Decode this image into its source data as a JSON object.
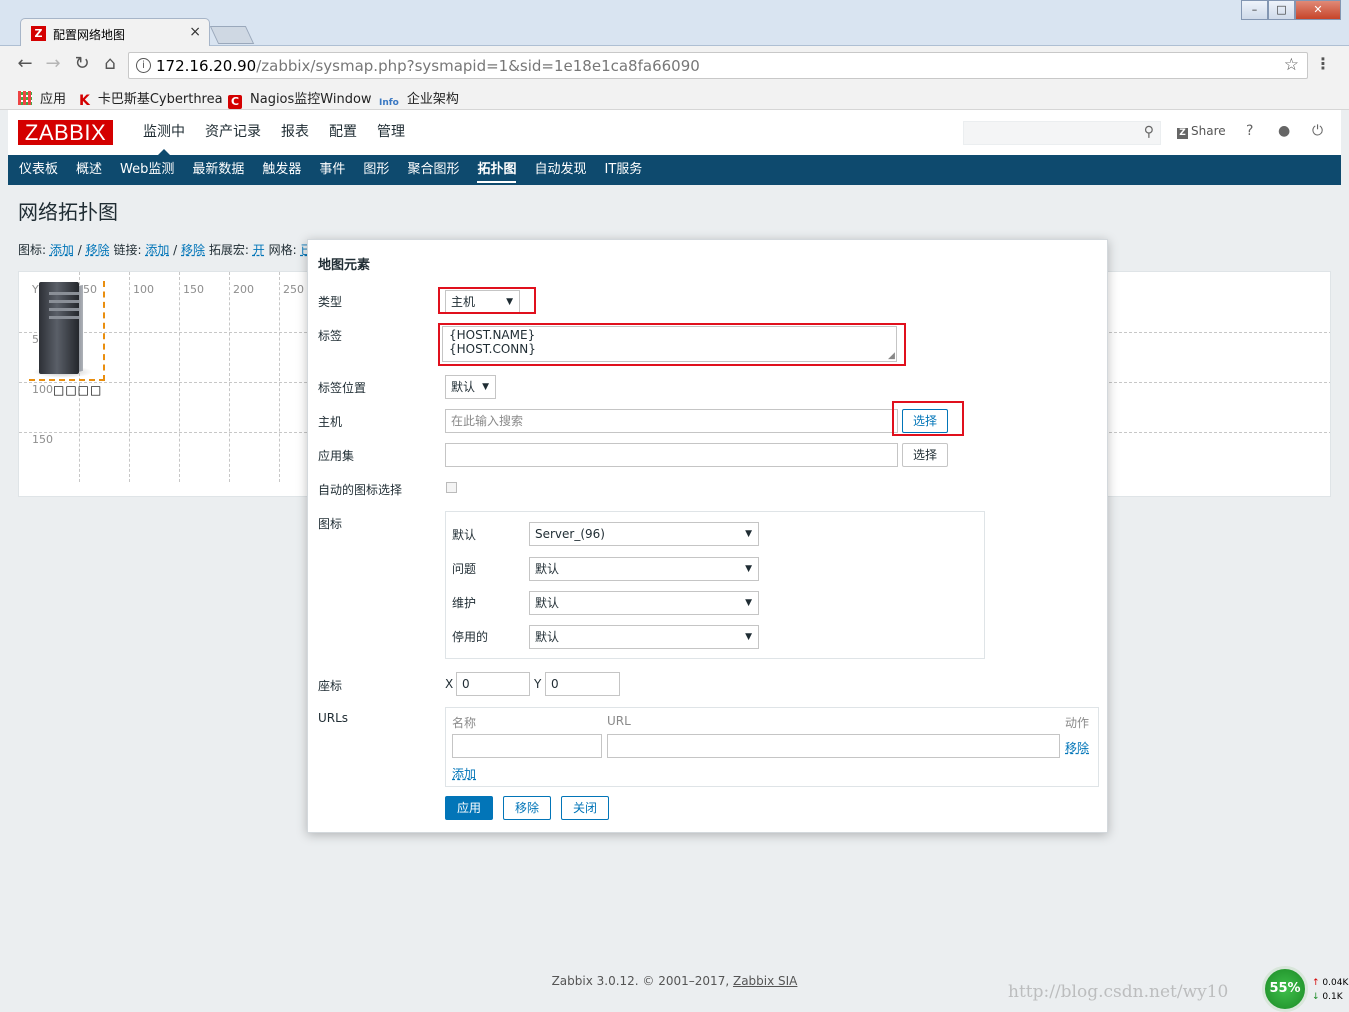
{
  "browser": {
    "tab_title": "配置网络地图",
    "tab_close": "×",
    "url_host": "172.16.20.90",
    "url_path": "/zabbix/sysmap.php?sysmapid=1&sid=1e18e1ca8fa66090",
    "bookmarks": [
      "应用",
      "卡巴斯基Cyberthrea",
      "Nagios监控Window",
      "企业架构"
    ]
  },
  "zabbix": {
    "logo": "ZABBIX",
    "top_menu": [
      "监测中",
      "资产记录",
      "报表",
      "配置",
      "管理"
    ],
    "share_label": "Share",
    "help_icon": "?",
    "sub_menu": [
      "仪表板",
      "概述",
      "Web监测",
      "最新数据",
      "触发器",
      "事件",
      "图形",
      "聚合图形",
      "拓扑图",
      "自动发现",
      "IT服务"
    ]
  },
  "page": {
    "title": "网络拓扑图",
    "controls": {
      "icon_label": "图标:",
      "add": "添加",
      "sep": "/",
      "remove": "移除",
      "link_label": "链接:",
      "expand_label": "拓展宏:",
      "expand_value": "开",
      "grid_label": "网格:",
      "grid_value": "已"
    },
    "grid_labels_x": [
      "50",
      "100",
      "150",
      "200",
      "250"
    ],
    "grid_labels_y": [
      "Y",
      "5",
      "100",
      "150"
    ],
    "element_label": "□□□□"
  },
  "dialog": {
    "title": "地图元素",
    "type_label": "类型",
    "type_value": "主机",
    "label_label": "标签",
    "label_value": "{HOST.NAME}\n{HOST.CONN}",
    "label_location_label": "标签位置",
    "label_location_value": "默认",
    "host_label": "主机",
    "host_placeholder": "在此输入搜索",
    "select_button": "选择",
    "application_label": "应用集",
    "auto_icon_label": "自动的图标选择",
    "icons_label": "图标",
    "icons": [
      {
        "label": "默认",
        "value": "Server_(96)"
      },
      {
        "label": "问题",
        "value": "默认"
      },
      {
        "label": "维护",
        "value": "默认"
      },
      {
        "label": "停用的",
        "value": "默认"
      }
    ],
    "coords_label": "座标",
    "x_label": "X",
    "x_value": "0",
    "y_label": "Y",
    "y_value": "0",
    "urls_label": "URLs",
    "url_col_name": "名称",
    "url_col_url": "URL",
    "url_col_action": "动作",
    "url_remove": "移除",
    "url_add": "添加",
    "apply_button": "应用",
    "remove_button": "移除",
    "close_button": "关闭"
  },
  "footer": {
    "text": "Zabbix 3.0.12. © 2001–2017, ",
    "link": "Zabbix SIA"
  },
  "overlay": {
    "watermark": "http://blog.csdn.net/wy10",
    "gauge": "55%",
    "net_up": "0.04K",
    "net_down": "0.1K"
  },
  "colors": {
    "brand_red": "#d40000",
    "nav_blue": "#0e4a6e",
    "link_blue": "#0275b8",
    "highlight_red": "#e0101d",
    "selection_orange": "#e98e0f"
  }
}
